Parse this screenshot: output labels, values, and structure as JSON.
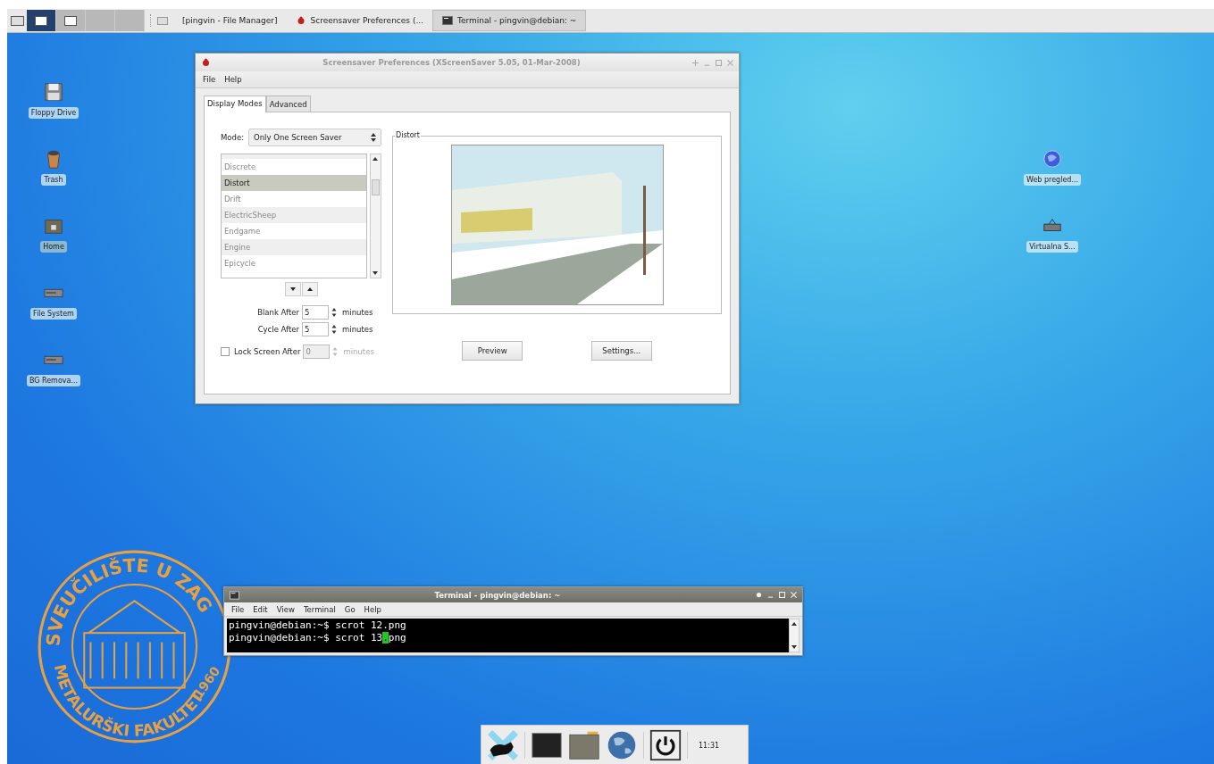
{
  "taskbar": {
    "workspaces": [
      {
        "selected": true
      },
      {
        "selected": false
      },
      {
        "selected": false
      },
      {
        "selected": false
      }
    ],
    "tasks": [
      {
        "label": "[pingvin - File Manager]",
        "kind": "folder",
        "selected": false
      },
      {
        "label": "Screensaver Preferences  (...",
        "kind": "bug",
        "selected": false
      },
      {
        "label": "Terminal - pingvin@debian: ~",
        "kind": "terminal",
        "selected": true
      }
    ]
  },
  "desktop_icons": [
    {
      "label": "Floppy Drive",
      "kind": "floppy",
      "selected": false
    },
    {
      "label": "Trash",
      "kind": "trash",
      "selected": false
    },
    {
      "label": "Home",
      "kind": "home",
      "selected": true
    },
    {
      "label": "File System",
      "kind": "drive",
      "selected": false
    },
    {
      "label": "BG Remova...",
      "kind": "drive",
      "selected": false
    },
    {
      "label": "Web pregled...",
      "kind": "globe",
      "selected": false
    },
    {
      "label": "Virtualna  S...",
      "kind": "network",
      "selected": false
    }
  ],
  "wallpaper_seal": {
    "top": "SVEUČILIŠTE U ZAG",
    "bottom": "METALURŠKI FAKULTET",
    "year": "1960"
  },
  "screensaver_window": {
    "title": "Screensaver Preferences  (XScreenSaver 5.05, 01-Mar-2008)",
    "menu": [
      "File",
      "Help"
    ],
    "tabs": [
      {
        "label": "Display Modes",
        "selected": true
      },
      {
        "label": "Advanced",
        "selected": false
      }
    ],
    "mode_label": "Mode:",
    "mode_value": "Only One Screen Saver",
    "savers": [
      {
        "label": "Discrete",
        "selected": false
      },
      {
        "label": "Distort",
        "selected": true
      },
      {
        "label": "Drift",
        "selected": false
      },
      {
        "label": "ElectricSheep",
        "selected": false
      },
      {
        "label": "Endgame",
        "selected": false
      },
      {
        "label": "Engine",
        "selected": false
      },
      {
        "label": "Epicycle",
        "selected": false
      }
    ],
    "timers": [
      {
        "label": "Blank After",
        "value": "5",
        "unit": "minutes",
        "kind": "plain",
        "disabled": false
      },
      {
        "label": "Cycle After",
        "value": "5",
        "unit": "minutes",
        "kind": "plain",
        "disabled": false
      },
      {
        "label": "Lock Screen After",
        "value": "0",
        "unit": "minutes",
        "kind": "checkbox",
        "checked": false,
        "disabled": true
      }
    ],
    "preview_title": "Distort",
    "buttons": [
      "Preview",
      "Settings..."
    ]
  },
  "terminal_window": {
    "title": "Terminal - pingvin@debian: ~",
    "menu": [
      "File",
      "Edit",
      "View",
      "Terminal",
      "Go",
      "Help"
    ],
    "lines": [
      {
        "before": "pingvin@debian:~$ scrot 12.png"
      },
      {
        "before": "pingvin@debian:~$ scrot 13",
        "cursor": ".",
        "after": "png"
      }
    ]
  },
  "dock": {
    "clock": "11:31"
  }
}
